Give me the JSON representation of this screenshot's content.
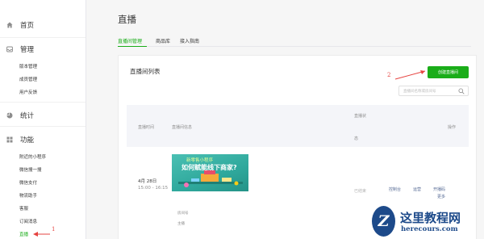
{
  "sidebar": {
    "sections": [
      {
        "label": "首页",
        "icon": "home-icon"
      },
      {
        "label": "管理",
        "icon": "inbox-icon",
        "items": [
          "版本管理",
          "成员管理",
          "用户反馈"
        ]
      },
      {
        "label": "统计",
        "icon": "pie-chart-icon"
      },
      {
        "label": "功能",
        "icon": "grid-icon",
        "items": [
          "附近的小程序",
          "微信搜一搜",
          "微信支付",
          "物流助手",
          "客服",
          "订阅消息",
          "直播"
        ]
      }
    ]
  },
  "main": {
    "title": "直播",
    "tabs": [
      "直播间管理",
      "商品库",
      "接入指南"
    ],
    "panel": {
      "title": "直播间列表",
      "create_button": "创建直播间",
      "search_placeholder": "直播间名称或房间号",
      "columns": {
        "time": "直播时间",
        "info": "直播间信息",
        "status_line1": "直播状",
        "status_line2": "态",
        "actions": "操作"
      },
      "rows": [
        {
          "date": "4月 28日",
          "time": "15:00 - 16:15",
          "cover_line1": "新零售小程序",
          "cover_line2": "如何赋能线下商家?",
          "room_label": "房间号",
          "anchor_label": "主播",
          "status": "已结束",
          "actions": [
            "控制台",
            "运营",
            "开播码",
            "更多"
          ]
        }
      ]
    }
  },
  "annotations": {
    "step1": "1",
    "step2": "2",
    "color": "#e64340"
  },
  "watermark": {
    "title": "这里教程网",
    "url": "herecours.com",
    "letter": "Z"
  },
  "colors": {
    "accent": "#1aad19",
    "link": "#576b95"
  }
}
